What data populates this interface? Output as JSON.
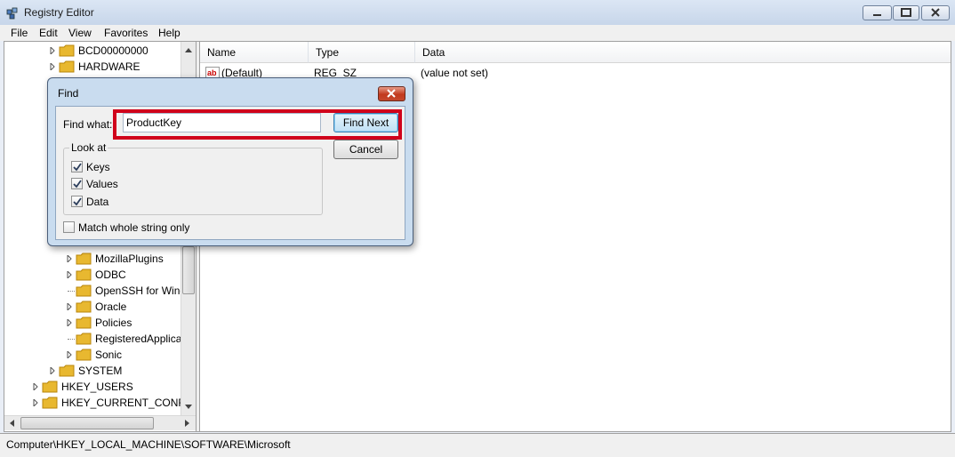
{
  "window": {
    "title": "Registry Editor"
  },
  "menu": {
    "file": "File",
    "edit": "Edit",
    "view": "View",
    "favorites": "Favorites",
    "help": "Help"
  },
  "tree": {
    "items": [
      {
        "label": "BCD00000000",
        "expandable": true
      },
      {
        "label": "HARDWARE",
        "expandable": true
      },
      {
        "label": "MozillaPlugins",
        "expandable": true
      },
      {
        "label": "ODBC",
        "expandable": true
      },
      {
        "label": "OpenSSH for Windows",
        "expandable": false
      },
      {
        "label": "Oracle",
        "expandable": true
      },
      {
        "label": "Policies",
        "expandable": true
      },
      {
        "label": "RegisteredApplications",
        "expandable": false
      },
      {
        "label": "Sonic",
        "expandable": true
      },
      {
        "label": "SYSTEM",
        "expandable": true
      },
      {
        "label": "HKEY_USERS",
        "expandable": true
      },
      {
        "label": "HKEY_CURRENT_CONFIG",
        "expandable": true
      }
    ]
  },
  "list": {
    "columns": {
      "name": "Name",
      "type": "Type",
      "data": "Data"
    },
    "rows": [
      {
        "name": "(Default)",
        "type": "REG_SZ",
        "data": "(value not set)",
        "icon": "ab-icon"
      }
    ]
  },
  "status": {
    "path": "Computer\\HKEY_LOCAL_MACHINE\\SOFTWARE\\Microsoft"
  },
  "find_dialog": {
    "title": "Find",
    "find_what_label": "Find what:",
    "find_what_value": "ProductKey",
    "find_next_label": "Find Next",
    "cancel_label": "Cancel",
    "look_at_label": "Look at",
    "keys_label": "Keys",
    "keys_checked": true,
    "values_label": "Values",
    "values_checked": true,
    "data_label": "Data",
    "data_checked": true,
    "match_label": "Match whole string only",
    "match_checked": false
  },
  "colors": {
    "highlight": "#d0021b",
    "folder": "#e8b830"
  }
}
